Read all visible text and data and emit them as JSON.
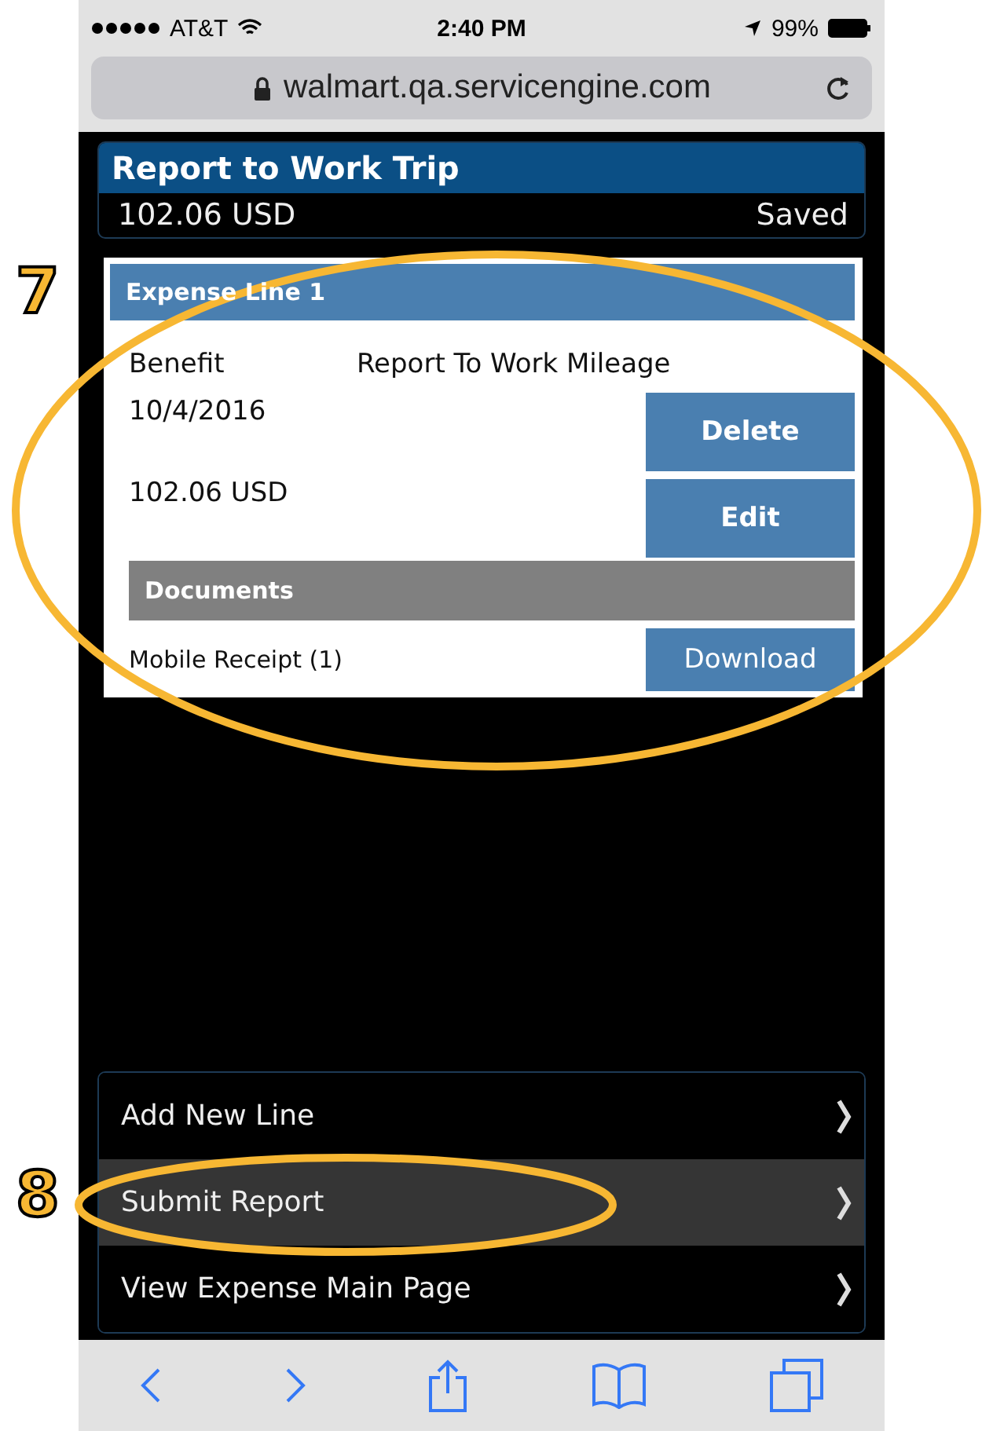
{
  "status_bar": {
    "carrier": "AT&T",
    "time": "2:40 PM",
    "battery": "99%"
  },
  "address_bar": {
    "url": "walmart.qa.servicengine.com"
  },
  "report": {
    "title": "Report to Work Trip",
    "amount": "102.06 USD",
    "status": "Saved"
  },
  "expense_line": {
    "title": "Expense Line 1",
    "type_label": "Benefit",
    "type_value": "Report To Work Mileage",
    "date": "10/4/2016",
    "amount": "102.06 USD",
    "buttons": [
      "Delete",
      "Edit"
    ],
    "documents": {
      "title": "Documents",
      "items": [
        {
          "name": "Mobile Receipt (1)",
          "action": "Download"
        }
      ]
    }
  },
  "menu": [
    {
      "label": "Add New Line",
      "selected": false
    },
    {
      "label": "Submit Report",
      "selected": true
    },
    {
      "label": "View Expense Main Page",
      "selected": false
    }
  ],
  "annotations": [
    {
      "label": "7"
    },
    {
      "label": "8"
    }
  ]
}
